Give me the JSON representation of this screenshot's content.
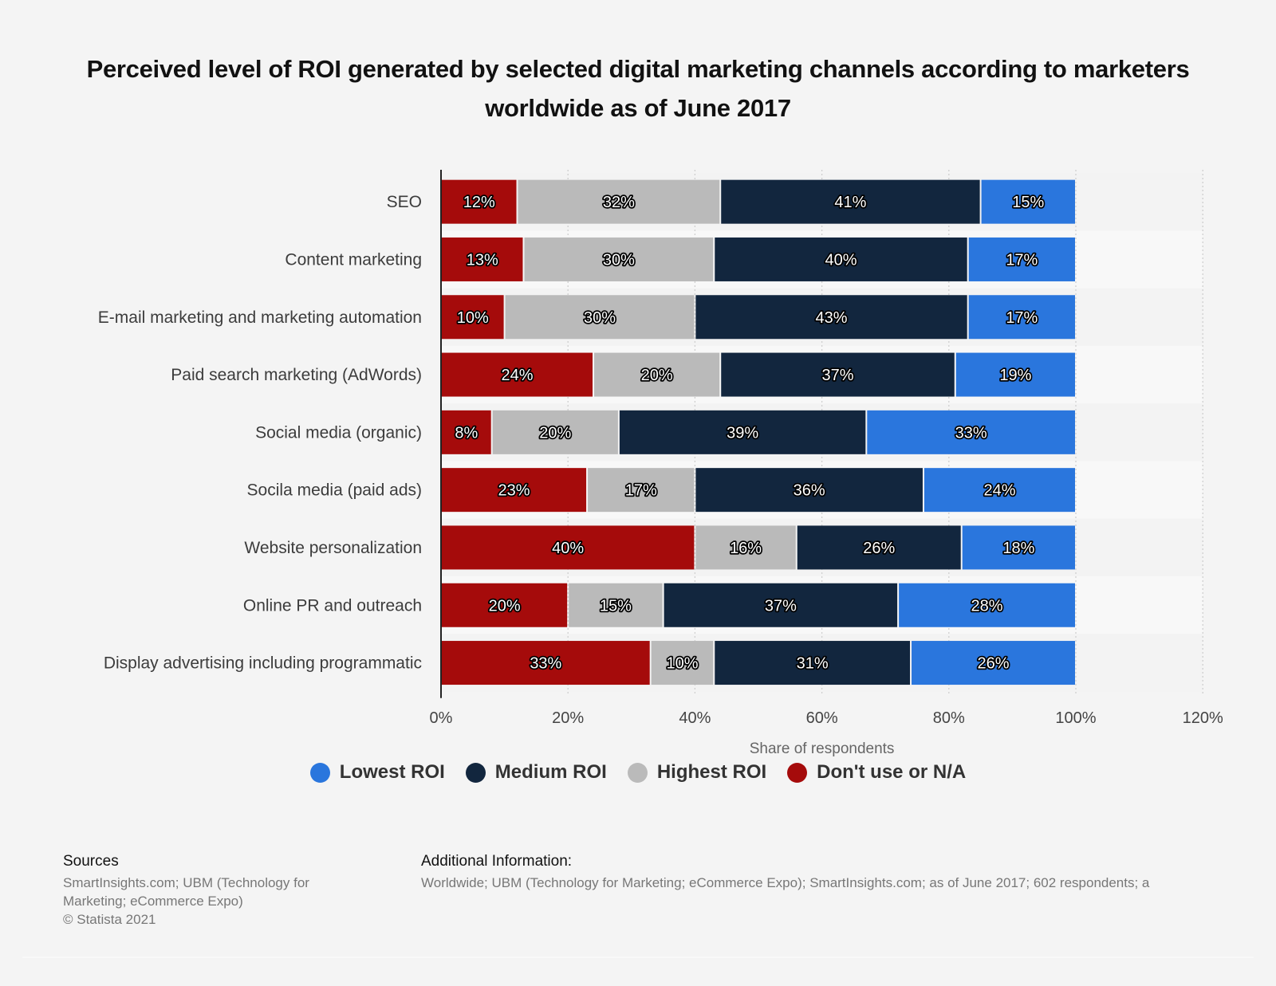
{
  "title": "Perceived level of ROI generated by selected digital marketing channels according to marketers worldwide as of June 2017",
  "chart_data": {
    "type": "bar",
    "orientation": "horizontal",
    "stacked": true,
    "title": "Perceived level of ROI generated by selected digital marketing channels according to marketers worldwide as of June 2017",
    "xlabel": "Share of respondents",
    "ylabel": "",
    "xlim": [
      0,
      120
    ],
    "x_ticks": [
      "0%",
      "20%",
      "40%",
      "60%",
      "80%",
      "100%",
      "120%"
    ],
    "x_tick_values": [
      0,
      20,
      40,
      60,
      80,
      100,
      120
    ],
    "grid": true,
    "legend_position": "bottom",
    "categories": [
      "SEO",
      "Content marketing",
      "E-mail marketing and marketing automation",
      "Paid search marketing (AdWords)",
      "Social media (organic)",
      "Socila media (paid ads)",
      "Website personalization",
      "Online PR and outreach",
      "Display advertising including programmatic"
    ],
    "series": [
      {
        "name": "Don't use or N/A",
        "color": "#a50b0b",
        "values": [
          12,
          13,
          10,
          24,
          8,
          23,
          40,
          20,
          33
        ]
      },
      {
        "name": "Highest ROI",
        "color": "#bababa",
        "values": [
          32,
          30,
          30,
          20,
          20,
          17,
          16,
          15,
          10
        ]
      },
      {
        "name": "Medium ROI",
        "color": "#12263e",
        "values": [
          41,
          40,
          43,
          37,
          39,
          36,
          26,
          37,
          31
        ]
      },
      {
        "name": "Lowest ROI",
        "color": "#2a76dd",
        "values": [
          15,
          17,
          17,
          19,
          33,
          24,
          18,
          28,
          26
        ]
      }
    ],
    "value_label_suffix": "%"
  },
  "legend": [
    {
      "label": "Lowest ROI",
      "color": "#2a76dd"
    },
    {
      "label": "Medium ROI",
      "color": "#12263e"
    },
    {
      "label": "Highest ROI",
      "color": "#bababa"
    },
    {
      "label": "Don't use or N/A",
      "color": "#a50b0b"
    }
  ],
  "footer": {
    "sources_heading": "Sources",
    "sources_line1": "SmartInsights.com; UBM (Technology for",
    "sources_line2": "Marketing; eCommerce Expo)",
    "copyright": "© Statista 2021",
    "additional_heading": "Additional Information:",
    "additional_text": "Worldwide; UBM (Technology for Marketing; eCommerce Expo); SmartInsights.com; as of June 2017; 602 respondents; a"
  }
}
